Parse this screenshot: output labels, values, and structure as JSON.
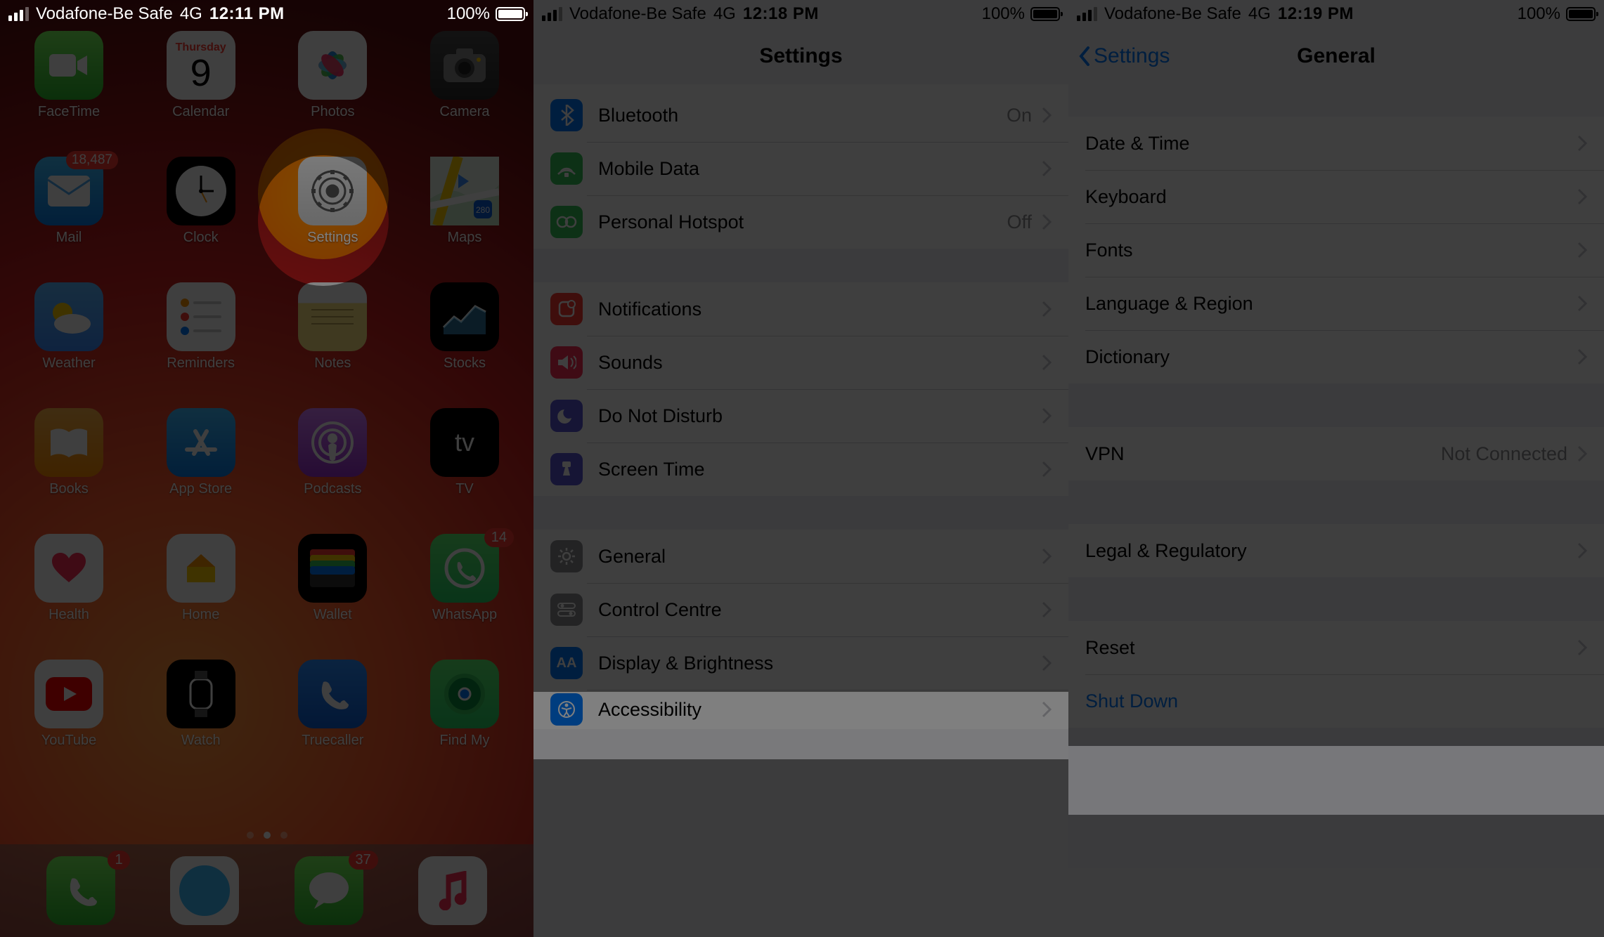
{
  "panel1": {
    "statusbar": {
      "carrier": "Vodafone-Be Safe",
      "network": "4G",
      "time": "12:11 PM",
      "battery": "100%"
    },
    "apps": [
      {
        "name": "FaceTime"
      },
      {
        "name": "Calendar",
        "day": "Thursday",
        "date": "9"
      },
      {
        "name": "Photos"
      },
      {
        "name": "Camera"
      },
      {
        "name": "Mail",
        "badge": "18,487"
      },
      {
        "name": "Clock"
      },
      {
        "name": "Settings",
        "highlighted": true
      },
      {
        "name": "Maps"
      },
      {
        "name": "Weather"
      },
      {
        "name": "Reminders"
      },
      {
        "name": "Notes"
      },
      {
        "name": "Stocks"
      },
      {
        "name": "Books"
      },
      {
        "name": "App Store"
      },
      {
        "name": "Podcasts"
      },
      {
        "name": "TV"
      },
      {
        "name": "Health"
      },
      {
        "name": "Home"
      },
      {
        "name": "Wallet"
      },
      {
        "name": "WhatsApp",
        "badge": "14"
      },
      {
        "name": "YouTube"
      },
      {
        "name": "Watch"
      },
      {
        "name": "Truecaller"
      },
      {
        "name": "Find My"
      }
    ],
    "dock": [
      {
        "name": "Phone",
        "badge": "1"
      },
      {
        "name": "Safari"
      },
      {
        "name": "Messages",
        "badge": "37"
      },
      {
        "name": "Music"
      }
    ]
  },
  "panel2": {
    "statusbar": {
      "carrier": "Vodafone-Be Safe",
      "network": "4G",
      "time": "12:18 PM",
      "battery": "100%"
    },
    "title": "Settings",
    "rows": [
      {
        "icon": "bluetooth",
        "color": "#007aff",
        "label": "Bluetooth",
        "value": "On"
      },
      {
        "icon": "mobiledata",
        "color": "#34c759",
        "label": "Mobile Data"
      },
      {
        "icon": "hotspot",
        "color": "#34c759",
        "label": "Personal Hotspot",
        "value": "Off"
      }
    ],
    "rows2": [
      {
        "icon": "notifications",
        "color": "#ff3b30",
        "label": "Notifications"
      },
      {
        "icon": "sounds",
        "color": "#ff3b30",
        "label": "Sounds"
      },
      {
        "icon": "dnd",
        "color": "#5856d6",
        "label": "Do Not Disturb"
      },
      {
        "icon": "screentime",
        "color": "#5856d6",
        "label": "Screen Time"
      }
    ],
    "rows3": [
      {
        "icon": "general",
        "color": "#8e8e93",
        "label": "General",
        "highlighted": true
      },
      {
        "icon": "controlcentre",
        "color": "#8e8e93",
        "label": "Control Centre"
      },
      {
        "icon": "display",
        "color": "#007aff",
        "label": "Display & Brightness"
      },
      {
        "icon": "accessibility",
        "color": "#007aff",
        "label": "Accessibility"
      }
    ]
  },
  "panel3": {
    "statusbar": {
      "carrier": "Vodafone-Be Safe",
      "network": "4G",
      "time": "12:19 PM",
      "battery": "100%"
    },
    "back": "Settings",
    "title": "General",
    "rows1": [
      {
        "label": "Date & Time"
      },
      {
        "label": "Keyboard"
      },
      {
        "label": "Fonts"
      },
      {
        "label": "Language & Region"
      },
      {
        "label": "Dictionary"
      }
    ],
    "rows2": [
      {
        "label": "VPN",
        "value": "Not Connected"
      }
    ],
    "rows3": [
      {
        "label": "Legal & Regulatory"
      }
    ],
    "rows4": [
      {
        "label": "Reset",
        "highlighted": true
      },
      {
        "label": "Shut Down",
        "link": true
      }
    ]
  }
}
